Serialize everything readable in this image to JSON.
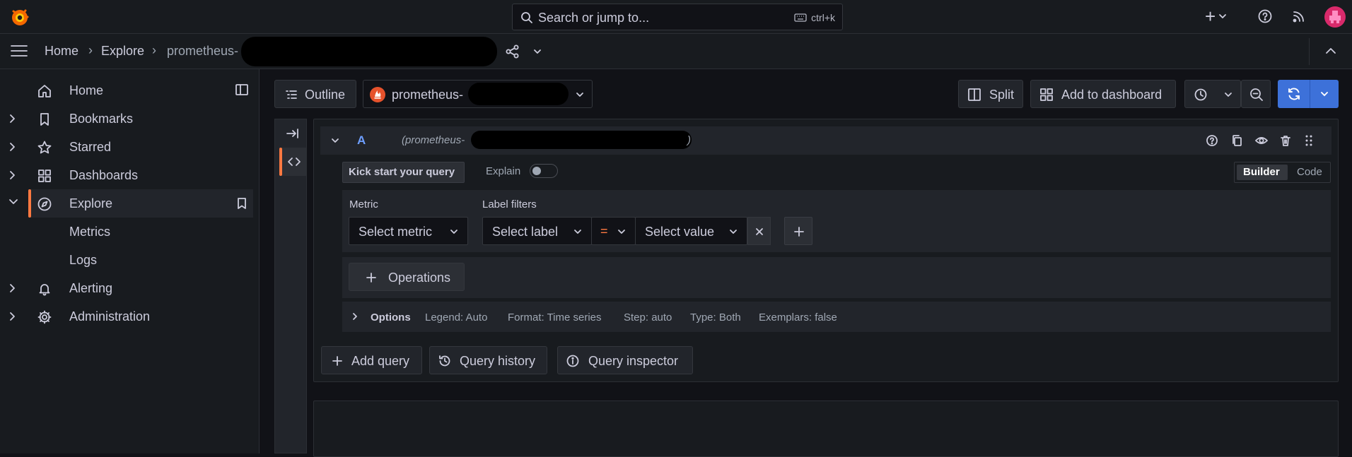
{
  "topbar": {
    "search_placeholder": "Search or jump to...",
    "search_shortcut": "ctrl+k",
    "new_label": "+"
  },
  "breadcrumb": {
    "home": "Home",
    "explore": "Explore",
    "datasource_prefix": "prometheus-"
  },
  "sidebar": {
    "items": [
      {
        "label": "Home"
      },
      {
        "label": "Bookmarks"
      },
      {
        "label": "Starred"
      },
      {
        "label": "Dashboards"
      },
      {
        "label": "Explore"
      },
      {
        "label": "Metrics"
      },
      {
        "label": "Logs"
      },
      {
        "label": "Alerting"
      },
      {
        "label": "Administration"
      }
    ]
  },
  "toolbar": {
    "outline_label": "Outline",
    "datasource_label": "prometheus-",
    "split_label": "Split",
    "add_dashboard_label": "Add to dashboard"
  },
  "query": {
    "ref_id": "A",
    "datasource_hint_prefix": "(prometheus-",
    "datasource_hint_suffix": ")",
    "kickstart_label": "Kick start your query",
    "explain_label": "Explain",
    "mode_builder": "Builder",
    "mode_code": "Code",
    "metric_heading": "Metric",
    "label_filters_heading": "Label filters",
    "metric_placeholder": "Select metric",
    "label_placeholder": "Select label",
    "operator": "=",
    "value_placeholder": "Select value",
    "operations_label": "Operations",
    "options": {
      "title": "Options",
      "legend": "Legend: Auto",
      "format": "Format: Time series",
      "step": "Step: auto",
      "type": "Type: Both",
      "exemplars": "Exemplars: false"
    }
  },
  "actions": {
    "add_query": "Add query",
    "query_history": "Query history",
    "query_inspector": "Query inspector"
  },
  "colors": {
    "accent": "#ff7941",
    "primary": "#3d71d9",
    "link": "#6e9fff"
  }
}
